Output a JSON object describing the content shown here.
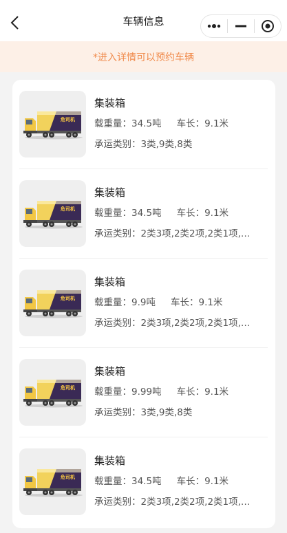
{
  "nav": {
    "title": "车辆信息"
  },
  "notice": "*进入详情可以预约车辆",
  "truck": {
    "brand_text": "危司机"
  },
  "items": [
    {
      "name": "集装箱",
      "weight_label": "载重量：",
      "weight": "34.5吨",
      "length_label": "车长：",
      "length": "9.1米",
      "cargo_label": "承运类别：",
      "cargo": "3类,9类,8类"
    },
    {
      "name": "集装箱",
      "weight_label": "载重量：",
      "weight": "34.5吨",
      "length_label": "车长：",
      "length": "9.1米",
      "cargo_label": "承运类别：",
      "cargo": "2类3项,2类2项,2类1项,…"
    },
    {
      "name": "集装箱",
      "weight_label": "载重量：",
      "weight": "9.9吨",
      "length_label": "车长：",
      "length": "9.1米",
      "cargo_label": "承运类别：",
      "cargo": "2类3项,2类2项,2类1项,…"
    },
    {
      "name": "集装箱",
      "weight_label": "载重量：",
      "weight": "9.99吨",
      "length_label": "车长：",
      "length": "9.1米",
      "cargo_label": "承运类别：",
      "cargo": "3类,9类,8类"
    },
    {
      "name": "集装箱",
      "weight_label": "载重量：",
      "weight": "34.5吨",
      "length_label": "车长：",
      "length": "9.1米",
      "cargo_label": "承运类别：",
      "cargo": "2类3项,2类2项,2类1项,…"
    }
  ]
}
